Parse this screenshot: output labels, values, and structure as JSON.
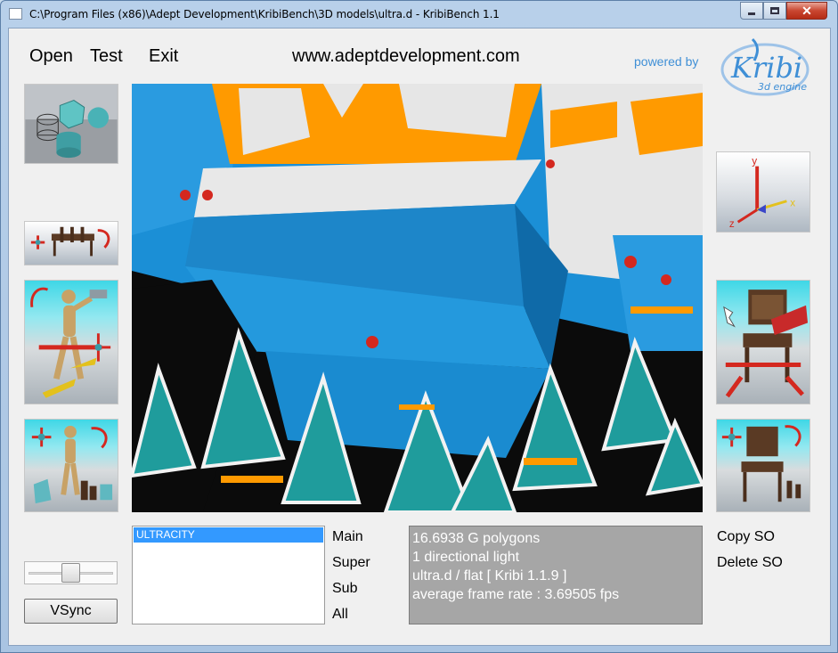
{
  "window": {
    "title": "C:\\Program Files (x86)\\Adept Development\\KribiBench\\3D models\\ultra.d - KribiBench 1.1",
    "close_glyph": "✕"
  },
  "menu": {
    "open": "Open",
    "test": "Test",
    "exit": "Exit"
  },
  "header": {
    "website": "www.adeptdevelopment.com",
    "powered_by": "powered by",
    "logo_name": "Kribi",
    "logo_tagline": "3d engine"
  },
  "axes_labels": {
    "x": "x",
    "y": "y",
    "z": "z"
  },
  "slider": {
    "value_fraction": 0.5
  },
  "vsync_label": "VSync",
  "object_list": {
    "items": [
      "ULTRACITY"
    ],
    "selected_index": 0
  },
  "levels": {
    "main": "Main",
    "super": "Super",
    "sub": "Sub",
    "all": "All"
  },
  "stats": {
    "polygons": "16.6938 G polygons",
    "lights": "1 directional light",
    "renderer": "ultra.d / flat [ Kribi 1.1.9 ]",
    "frame_rate": "average frame rate :  3.69505 fps"
  },
  "so_buttons": {
    "copy": "Copy SO",
    "delete": "Delete SO"
  },
  "colors": {
    "accent_blue": "#3f8fd6",
    "scene_blue": "#1b8fd6",
    "scene_orange": "#ff9a00",
    "scene_teal": "#1f9c9c",
    "stats_bg": "#a6a6a6",
    "selection": "#3399ff"
  }
}
